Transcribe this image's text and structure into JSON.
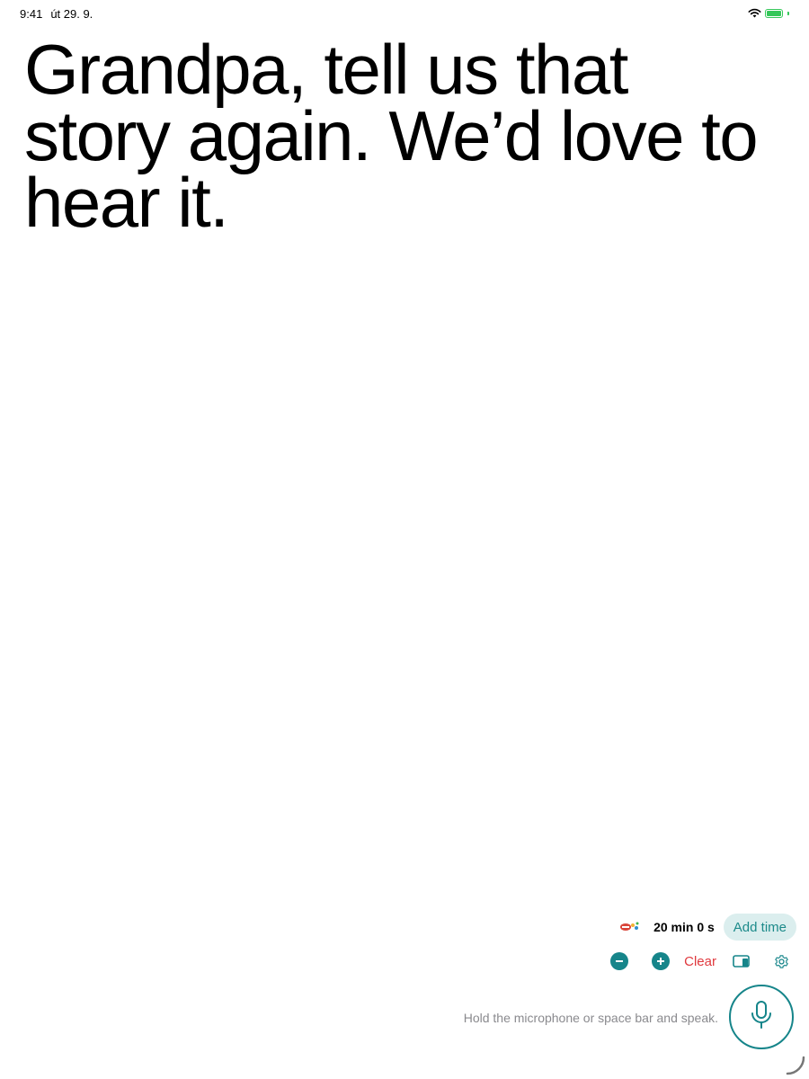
{
  "status_bar": {
    "time": "9:41",
    "date": "út 29. 9.",
    "wifi_icon": "wifi-icon",
    "battery_icon": "battery-charging-icon",
    "battery_level": 1.0
  },
  "phrase": {
    "text": "Grandpa, tell us that story again. We’d love to hear it."
  },
  "timer": {
    "logo_icon": "speech-lips-logo",
    "value": "20 min 0 s",
    "add_time_label": "Add time"
  },
  "controls": {
    "decrease_icon": "minus-circle-icon",
    "increase_icon": "plus-circle-icon",
    "clear_label": "Clear",
    "display_icon": "tablet-phone-icon",
    "settings_icon": "gear-icon"
  },
  "hint": {
    "text": "Hold the microphone or space bar and speak."
  },
  "mic": {
    "icon": "microphone-icon"
  },
  "colors": {
    "accent": "#16858a",
    "accent_light_bg": "#dbeeee",
    "danger": "#e0393e",
    "hint_gray": "#8a8a8e",
    "battery_green": "#34c759"
  }
}
